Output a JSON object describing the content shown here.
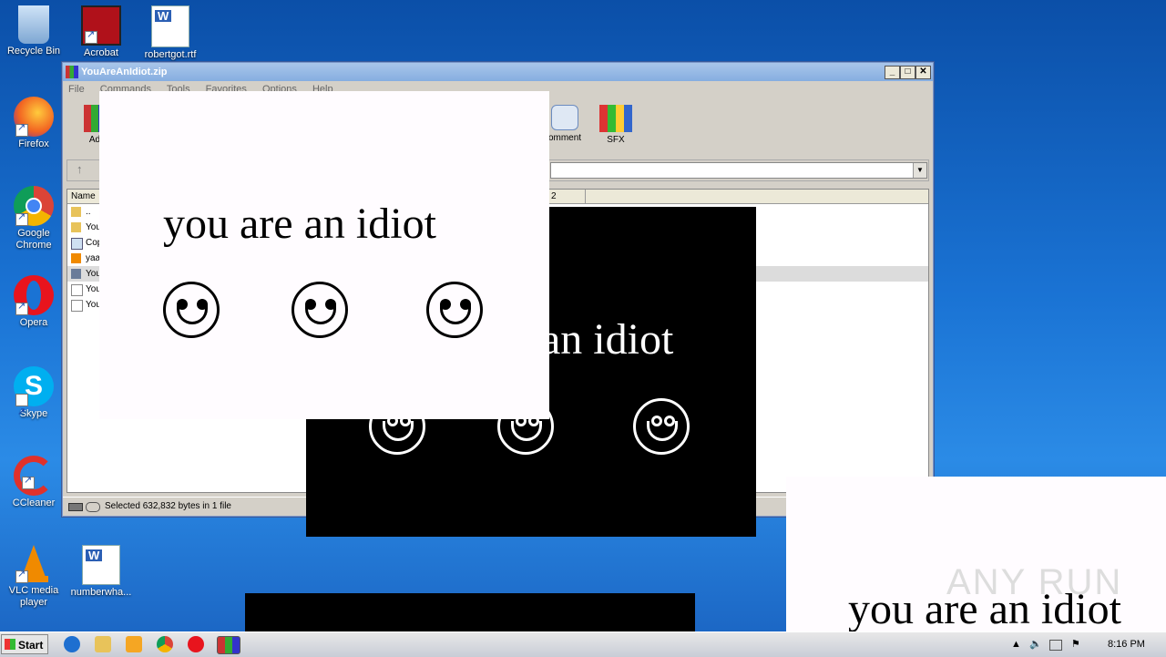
{
  "desktop": {
    "icons": [
      {
        "label": "Recycle Bin",
        "icon": "recycle-bin-icon"
      },
      {
        "label": "Acrobat",
        "icon": "acrobat-icon"
      },
      {
        "label": "robertgot.rtf",
        "icon": "word-document-icon"
      },
      {
        "label": "Firefox",
        "icon": "firefox-icon"
      },
      {
        "label": "Google Chrome",
        "icon": "chrome-icon"
      },
      {
        "label": "Opera",
        "icon": "opera-icon"
      },
      {
        "label": "Skype",
        "icon": "skype-icon"
      },
      {
        "label": "CCleaner",
        "icon": "ccleaner-icon"
      },
      {
        "label": "VLC media player",
        "icon": "vlc-icon"
      },
      {
        "label": "numberwha...",
        "icon": "word-document-icon"
      }
    ]
  },
  "winrar": {
    "title": "YouAreAnIdiot.zip",
    "menu": [
      "File",
      "Commands",
      "Tools",
      "Favorites",
      "Options",
      "Help"
    ],
    "toolbar": [
      {
        "label": "Ad",
        "icon": "add-icon"
      },
      {
        "label": "omment",
        "icon": "comment-icon"
      },
      {
        "label": "SFX",
        "icon": "sfx-icon"
      }
    ],
    "column_name": "Name",
    "column_partial": "2",
    "files": [
      {
        "name": "..",
        "icon": "folder-icon"
      },
      {
        "name": "You",
        "icon": "folder-icon"
      },
      {
        "name": "Cop",
        "icon": "image-file-icon"
      },
      {
        "name": "yaa",
        "icon": "vlc-file-icon"
      },
      {
        "name": "You",
        "icon": "exe-file-icon"
      },
      {
        "name": "You",
        "icon": "blank-file-icon"
      },
      {
        "name": "You",
        "icon": "blank-file-icon"
      }
    ],
    "status": "Selected 632,832 bytes in 1 file"
  },
  "popups": {
    "white_top": {
      "text": "you are an idiot"
    },
    "black_mid": {
      "text": "an idiot"
    },
    "white_bottom": {
      "text": "you are an idiot"
    }
  },
  "watermark": "ANY RUN",
  "taskbar": {
    "start_label": "Start",
    "clock": "8:16 PM",
    "pinned": [
      "internet-explorer-icon",
      "explorer-icon",
      "media-player-icon",
      "chrome-icon",
      "opera-icon",
      "winrar-icon"
    ]
  }
}
